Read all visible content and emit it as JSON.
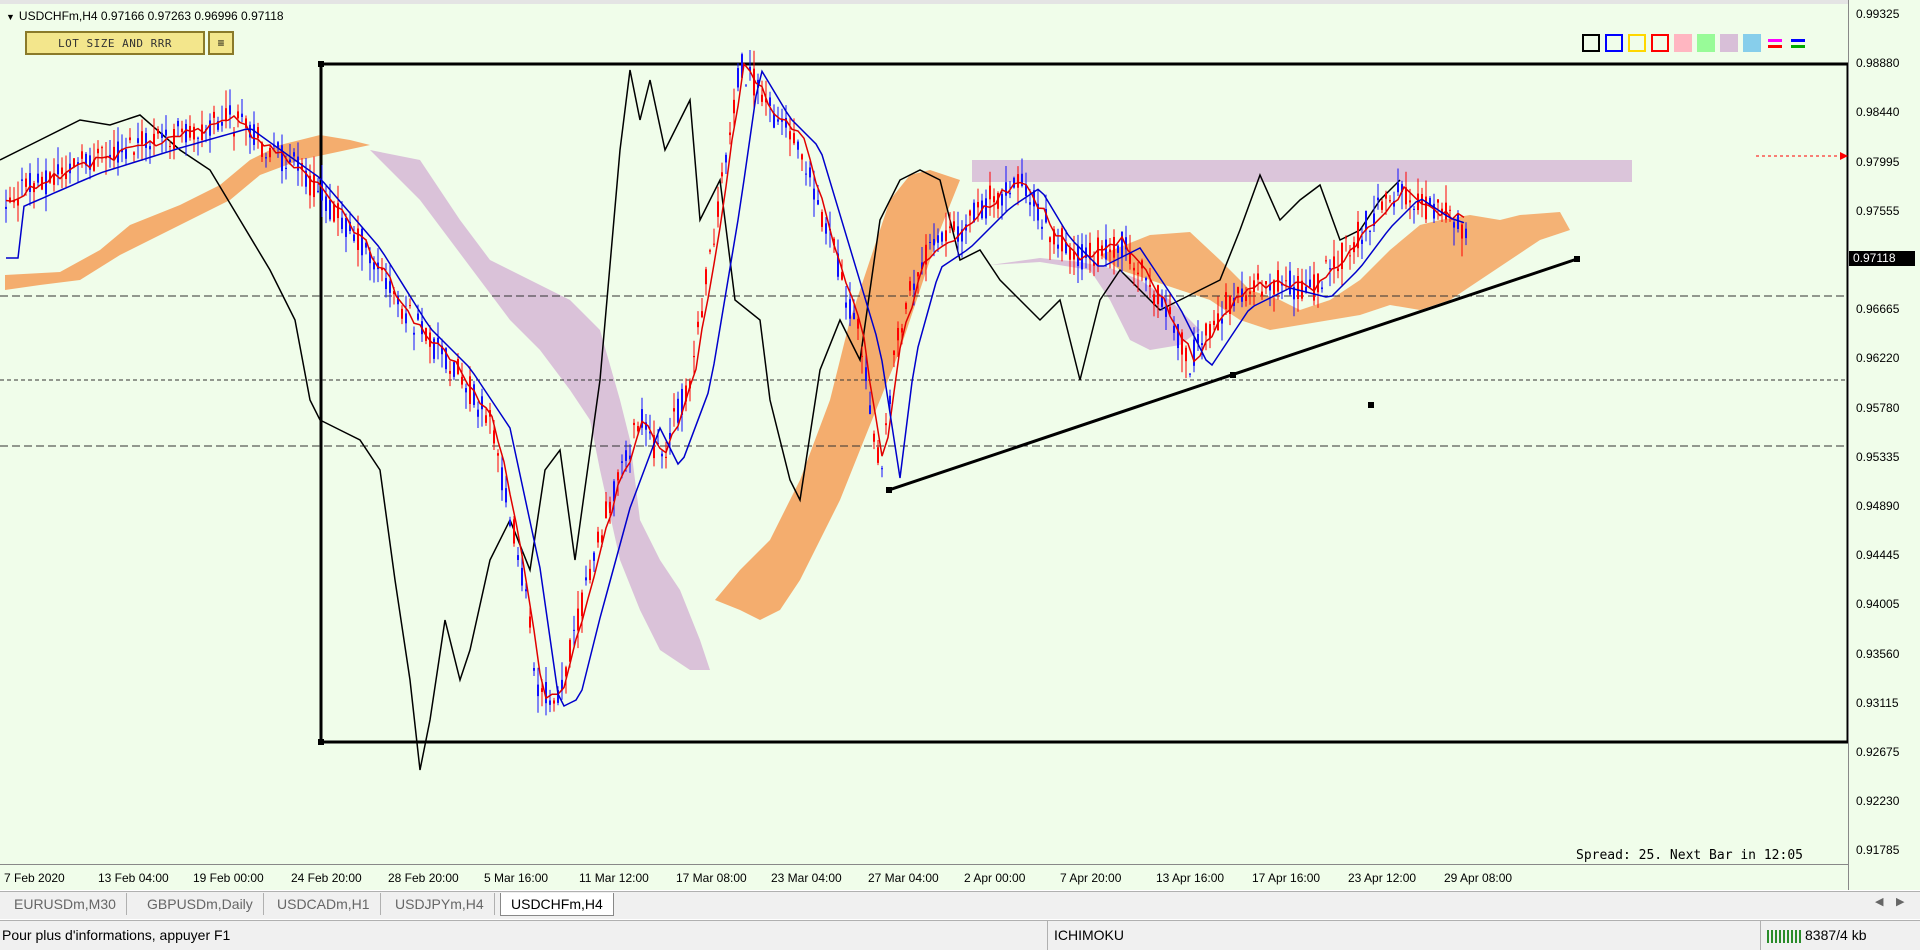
{
  "chart": {
    "symbol_line": "USDCHFm,H4  0.97166 0.97263 0.96996 0.97118",
    "lot_button": "LOT SIZE AND RRR",
    "lot_icon": "≡",
    "spread_text": "Spread: 25. Next Bar in 12:05",
    "current_price": "0.97118",
    "colors": {
      "background": "#f0fdea",
      "bull_candle": "#1010ff",
      "bear_candle": "#ff0000",
      "tenkan": "#e00000",
      "kijun": "#0000cc",
      "chikou": "#000000",
      "cloud_bull": "#f4a460",
      "cloud_bear": "#d8bfd8"
    }
  },
  "price_axis": [
    "0.99325",
    "0.98880",
    "0.98440",
    "0.97995",
    "0.97555",
    "0.97118",
    "0.96665",
    "0.96220",
    "0.95780",
    "0.95335",
    "0.94890",
    "0.94445",
    "0.94005",
    "0.93560",
    "0.93115",
    "0.92675",
    "0.92230",
    "0.91785"
  ],
  "time_axis": [
    "7 Feb 2020",
    "13 Feb 04:00",
    "19 Feb 00:00",
    "24 Feb 20:00",
    "28 Feb 20:00",
    "5 Mar 16:00",
    "11 Mar 12:00",
    "17 Mar 08:00",
    "23 Mar 04:00",
    "27 Mar 04:00",
    "2 Apr 00:00",
    "7 Apr 20:00",
    "13 Apr 16:00",
    "17 Apr 16:00",
    "23 Apr 12:00",
    "29 Apr 08:00"
  ],
  "palette": [
    {
      "name": "black-box",
      "color": "#000000",
      "fill": false
    },
    {
      "name": "blue-box",
      "color": "#0000ff",
      "fill": false
    },
    {
      "name": "yellow-box",
      "color": "#ffd700",
      "fill": false
    },
    {
      "name": "red-box",
      "color": "#ff0000",
      "fill": false
    },
    {
      "name": "pink-box",
      "color": "#ffb6c1",
      "fill": true
    },
    {
      "name": "green-box",
      "color": "#98fb98",
      "fill": true
    },
    {
      "name": "thistle-box",
      "color": "#d8bfd8",
      "fill": true
    },
    {
      "name": "sky-box",
      "color": "#87ceeb",
      "fill": true
    },
    {
      "name": "magenta-line",
      "color": "#ff00ff",
      "fill": false
    },
    {
      "name": "blue-green-line",
      "color": "#0000ff",
      "fill": false
    }
  ],
  "tabs": [
    "EURUSDm,M30",
    "GBPUSDm,Daily",
    "USDCADm,H1",
    "USDJPYm,H4",
    "USDCHFm,H4"
  ],
  "active_tab": "USDCHFm,H4",
  "status": {
    "help": "Pour plus d'informations, appuyer F1",
    "profile": "ICHIMOKU",
    "traffic": "8387/4 kb"
  }
}
